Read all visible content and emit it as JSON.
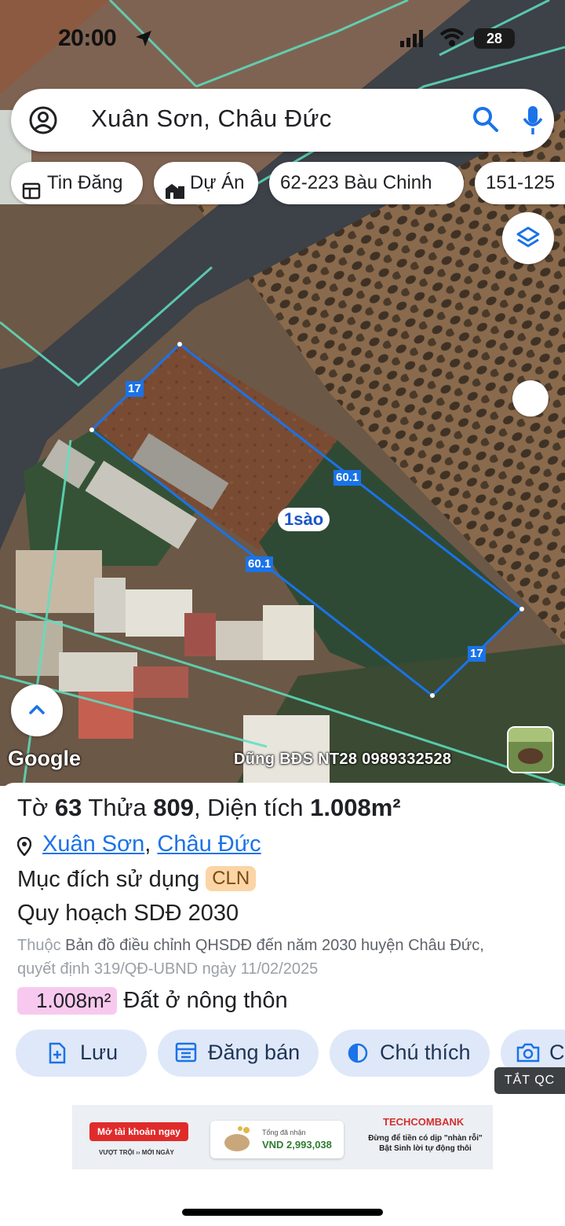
{
  "status_bar": {
    "time": "20:00",
    "battery": "28"
  },
  "search": {
    "text": "Xuân Sơn, Châu Đức"
  },
  "chips": [
    {
      "label": "Tin Đăng",
      "icon": "listing-icon"
    },
    {
      "label": "Dự Án",
      "icon": "building-icon"
    },
    {
      "label": "62-223 Bàu Chinh"
    },
    {
      "label": "151-125"
    }
  ],
  "map": {
    "edge_labels": [
      "17",
      "60.1",
      "60.1",
      "17"
    ],
    "area_label": "1sào",
    "google_logo": "Google",
    "watermark": "Dũng BĐS NT28 0989332528",
    "parcel_color": "#1a73e8"
  },
  "sheet": {
    "title_prefix": "Tờ ",
    "sheet_no": "63",
    "parcel_prefix": " Thửa ",
    "parcel_no": "809",
    "area_prefix": ", Diện tích ",
    "area_value": "1.008m²",
    "location_commune": "Xuân Sơn",
    "location_sep": ", ",
    "location_district": "Châu Đức",
    "purpose_label": "Mục đích sử dụng",
    "purpose_code": "CLN",
    "planning_label": "Quy hoạch SDĐ 2030",
    "planning_prefix": "Thuộc ",
    "planning_source": "Bản đồ điều chỉnh QHSDĐ đến năm 2030 huyện Châu Đức,",
    "planning_decision": "quyết định 319/QĐ-UBND ngày 11/02/2025",
    "zone_area": "1.008m²",
    "zone_desc": "Đất ở nông thôn"
  },
  "actions": [
    {
      "label": "Lưu"
    },
    {
      "label": "Đăng bán"
    },
    {
      "label": "Chú thích"
    },
    {
      "label": "C"
    }
  ],
  "ad_toggle": "TẮT QC",
  "ad": {
    "cta": "Mở tài khoản ngay",
    "tagline": "VƯỢT TRỘI ›› MỚI NGÀY",
    "balance_label": "Tổng đã nhận",
    "balance_value": "VND 2,993,038",
    "brand": "TECHCOMBANK",
    "slogan": "Đừng để tiền có dịp \"nhàn rỗi\" Bật Sinh lời tự động thôi"
  }
}
